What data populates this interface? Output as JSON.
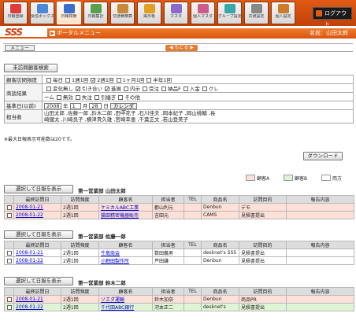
{
  "nav": [
    {
      "label": "日報登録",
      "color": "#e03a3a"
    },
    {
      "label": "受信ボックス",
      "color": "#4a88d8"
    },
    {
      "label": "日報検索",
      "color": "#3a6ecc"
    },
    {
      "label": "日報集計",
      "color": "#5aa04a"
    },
    {
      "label": "交通費精算",
      "color": "#c88a3a"
    },
    {
      "label": "掲示板",
      "color": "#e0a020"
    },
    {
      "label": "マスタ",
      "color": "#8a6ad0"
    },
    {
      "label": "個人マスタ",
      "color": "#d05a8a"
    },
    {
      "label": "グループ設定",
      "color": "#3aa8a8"
    },
    {
      "label": "共通設定",
      "color": "#888888"
    },
    {
      "label": "個人設定",
      "color": "#d07a2a"
    }
  ],
  "logout": "ログアウト",
  "logo": "SSS",
  "portal": {
    "title": "ポータルメニュー",
    "user": "名前：山田太郎"
  },
  "menu": {
    "tab": "メニュー",
    "back": "もどる"
  },
  "search_btn": "未訪問顧客検索",
  "form": {
    "freq_label": "顧客訪問頻度",
    "freq": [
      {
        "t": "毎日",
        "on": false
      },
      {
        "t": "1週1回",
        "on": false
      },
      {
        "t": "2週1回",
        "on": true
      },
      {
        "t": "1ヶ月1回",
        "on": false
      },
      {
        "t": "半年1回",
        "on": false
      }
    ],
    "result_label": "商談結果",
    "result1": [
      {
        "t": "変化無し",
        "on": false
      },
      {
        "t": "引き合い",
        "on": true
      },
      {
        "t": "進展",
        "on": true
      },
      {
        "t": "内示",
        "on": false
      },
      {
        "t": "受注",
        "on": false
      },
      {
        "t": "納品F",
        "on": false
      },
      {
        "t": "入金",
        "on": false
      },
      {
        "t": "クレ",
        "on": false
      }
    ],
    "result2_prefix": "ーム",
    "result2": [
      {
        "t": "無効",
        "on": false
      },
      {
        "t": "失注",
        "on": false
      },
      {
        "t": "引継ぎ",
        "on": false
      },
      {
        "t": "その他",
        "on": false
      }
    ],
    "date_label": "基準日(以前)",
    "year": "2008",
    "year_unit": "年",
    "month": "1",
    "month_unit": "月",
    "day": "28",
    "day_unit": "日",
    "calendar": "カレンダー",
    "staff_label": "担当者",
    "staff_line1": "山田太郎 ,佐藤一郎 ,鈴木二郎 ,田中花子 ,石川佳夫 ,岡本紀子 ,岡山桃輔 ,長",
    "staff_line2": "崎健太 ,川崎良子 ,横津貴久雄 ,宮崎幸恵 ,千葉正文 ,若山登美子"
  },
  "note": "※最大日報表示可能数は20です。",
  "download": "ダウンロード",
  "legend": {
    "a": "顧客A",
    "b": "顧客B",
    "both": "両方"
  },
  "colors": {
    "a": "#fde0d8",
    "b": "#dff5d6",
    "both": "#ffffff"
  },
  "groups": [
    {
      "btn": "選択して日報を表示",
      "title": "第一営業部 山田太郎",
      "headers": [
        "",
        "最終訪問日",
        "訪問頻度",
        "顧客名",
        "担当者",
        "TEL",
        "商品名",
        "訪問目的",
        "報告内容"
      ],
      "rows": [
        {
          "k": "a",
          "date": "2008-01-21",
          "freq": "2週1回",
          "cust": "ケミカルABC工業",
          "staff": "郡山利元",
          "tel": "",
          "prod": "Denbun",
          "purpose": "デモ",
          "report": ""
        },
        {
          "k": "a",
          "date": "2008-01-22",
          "freq": "2週1回",
          "cust": "猫田精密機器販売",
          "staff": "吉田元",
          "tel": "",
          "prod": "CAMS",
          "purpose": "見積書提出",
          "report": ""
        }
      ]
    },
    {
      "btn": "選択して日報を表示",
      "title": "第一営業部 佐藤一郎",
      "headers": [
        "",
        "最終訪問日",
        "訪問頻度",
        "顧客名",
        "担当者",
        "TEL",
        "商品名",
        "訪問目的",
        "報告内容"
      ],
      "rows": [
        {
          "k": "w",
          "date": "2008-01-21",
          "freq": "2週1回",
          "cust": "牛島商会",
          "staff": "数田義男",
          "tel": "",
          "prod": "desknet's SSS",
          "purpose": "見積書提出",
          "report": ""
        },
        {
          "k": "w",
          "date": "2008-01-22",
          "freq": "2週1回",
          "cust": "小野田製作所",
          "staff": "芦田謙",
          "tel": "",
          "prod": "Denbun",
          "purpose": "見積書提出",
          "report": ""
        }
      ]
    },
    {
      "btn": "選択して日報を表示",
      "title": "第一営業部 鈴木二郎",
      "headers": [
        "",
        "最終訪問日",
        "訪問頻度",
        "顧客名",
        "担当者",
        "TEL",
        "商品名",
        "訪問目的",
        "報告内容"
      ],
      "rows": [
        {
          "k": "a",
          "date": "2008-01-21",
          "freq": "2週1回",
          "cust": "ソエダ運輸",
          "staff": "鈴木加奈",
          "tel": "",
          "prod": "Denbun",
          "purpose": "商品PR",
          "report": ""
        },
        {
          "k": "b",
          "date": "2008-01-22",
          "freq": "2週1回",
          "cust": "千代田ABC銀行",
          "staff": "河本正二",
          "tel": "",
          "prod": "desknet's",
          "purpose": "見積書提出",
          "report": ""
        }
      ]
    }
  ]
}
